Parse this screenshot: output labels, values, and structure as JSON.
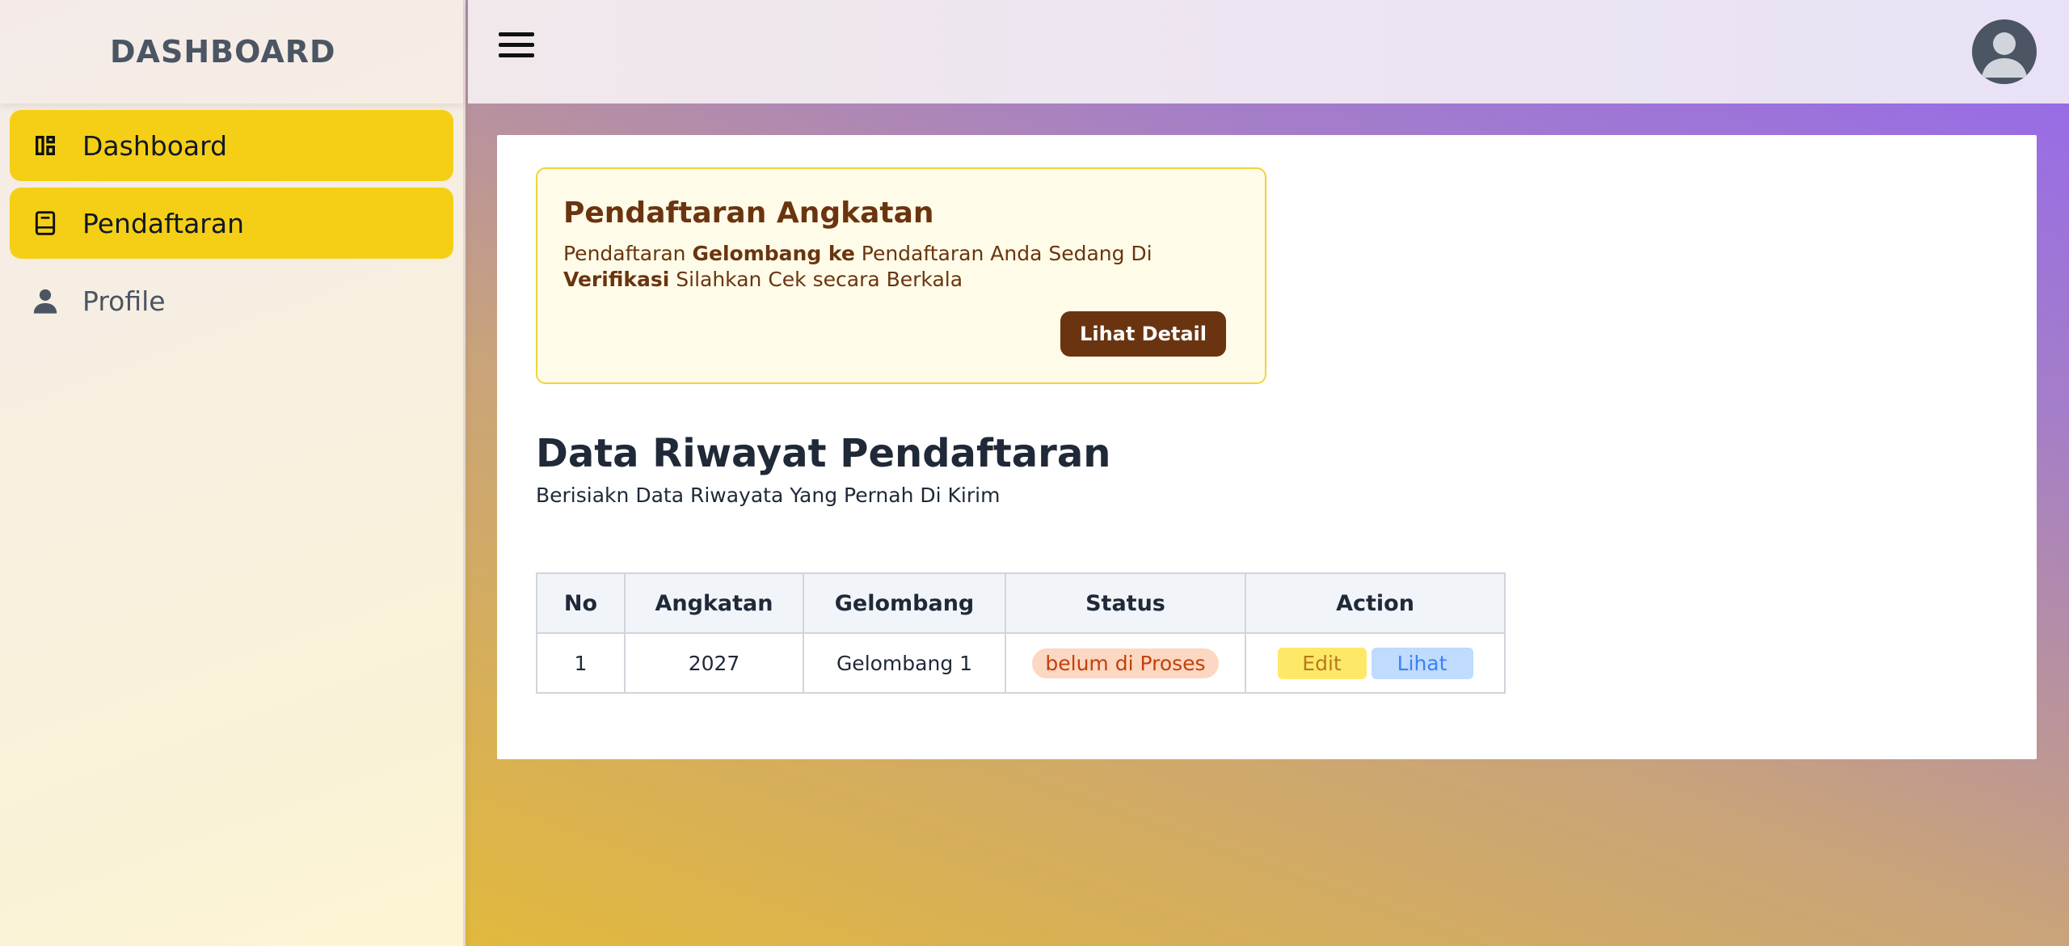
{
  "sidebar": {
    "brand": "DASHBOARD",
    "items": [
      {
        "label": "Dashboard",
        "icon": "dashboard-icon"
      },
      {
        "label": "Pendaftaran",
        "icon": "book-icon"
      },
      {
        "label": "Profile",
        "icon": "user-icon"
      }
    ]
  },
  "header": {
    "menu_icon": "hamburger-icon",
    "avatar_icon": "avatar-icon"
  },
  "alert": {
    "title": "Pendaftaran Angkatan",
    "text_1": "Pendaftaran ",
    "text_bold_1": "Gelombang ke",
    "text_2": " Pendaftaran Anda Sedang Di ",
    "text_bold_2": "Verifikasi",
    "text_3": " Silahkan Cek secara Berkala",
    "button": "Lihat Detail"
  },
  "main": {
    "title": "Data Riwayat Pendaftaran",
    "subtitle": "Berisiakn Data Riwayata Yang Pernah Di Kirim"
  },
  "table": {
    "headers": [
      "No",
      "Angkatan",
      "Gelombang",
      "Status",
      "Action"
    ],
    "rows": [
      {
        "no": "1",
        "angkatan": "2027",
        "gelombang": "Gelombang 1",
        "status": "belum di Proses",
        "edit": "Edit",
        "lihat": "Lihat"
      }
    ]
  },
  "colors": {
    "accent_yellow": "#f5cf16",
    "brown": "#6b3410",
    "status_bg": "#fcd7c1",
    "status_text": "#c2410c"
  }
}
